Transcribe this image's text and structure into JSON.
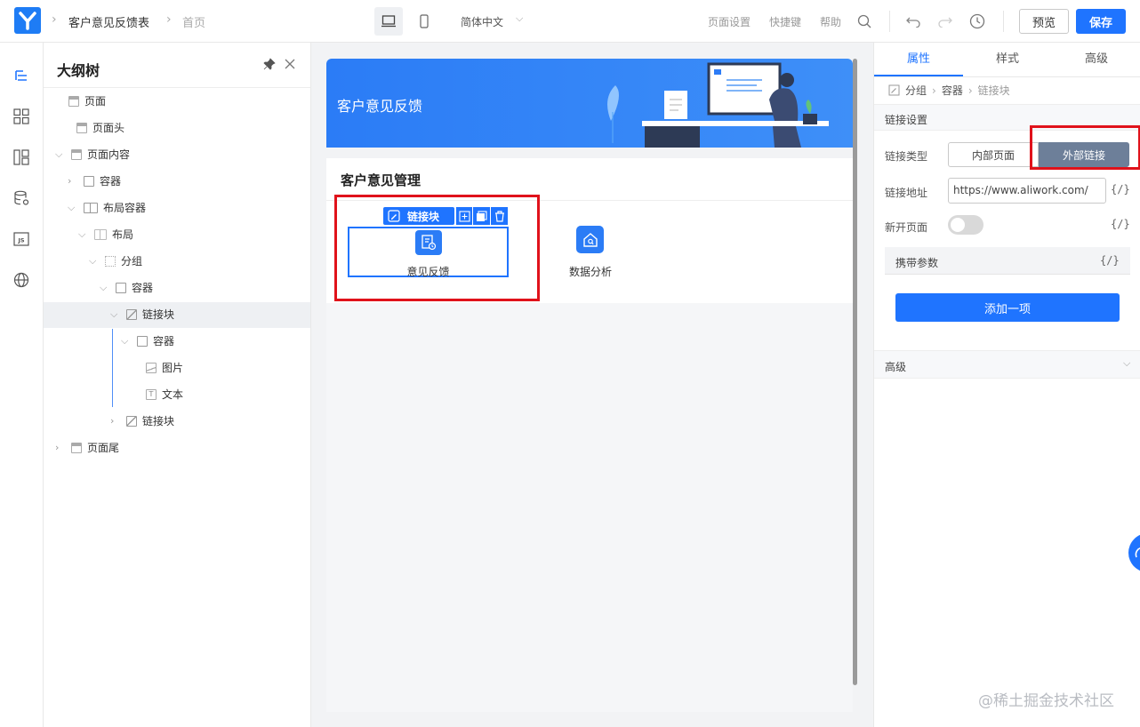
{
  "topbar": {
    "breadcrumb_form": "客户意见反馈表",
    "breadcrumb_page": "首页",
    "language": "简体中文",
    "page_settings": "页面设置",
    "shortcuts": "快捷键",
    "help": "帮助",
    "preview": "预览",
    "save": "保存",
    "accent": "#1f74ff"
  },
  "outline": {
    "title": "大纲树",
    "items": [
      {
        "label": "页面",
        "icon": "layout-icon"
      },
      {
        "label": "页面头",
        "icon": "layout-icon"
      },
      {
        "label": "页面内容",
        "icon": "layout-icon"
      },
      {
        "label": "容器",
        "icon": "container-icon"
      },
      {
        "label": "布局容器",
        "icon": "columns-icon"
      },
      {
        "label": "布局",
        "icon": "columns-icon"
      },
      {
        "label": "分组",
        "icon": "group-icon"
      },
      {
        "label": "容器",
        "icon": "container-icon"
      },
      {
        "label": "链接块",
        "icon": "link-block-icon"
      },
      {
        "label": "容器",
        "icon": "container-icon"
      },
      {
        "label": "图片",
        "icon": "image-icon"
      },
      {
        "label": "文本",
        "icon": "text-icon"
      },
      {
        "label": "链接块",
        "icon": "link-block-icon"
      },
      {
        "label": "页面尾",
        "icon": "layout-icon"
      }
    ]
  },
  "canvas": {
    "banner_title": "客户意见反馈",
    "section_title": "客户意见管理",
    "toolbar_label": "链接块",
    "links": [
      {
        "label": "意见反馈",
        "icon": "feedback-form-icon"
      },
      {
        "label": "数据分析",
        "icon": "home-search-icon"
      }
    ],
    "watermark": "@稀土掘金技术社区"
  },
  "panel": {
    "tabs": [
      "属性",
      "样式",
      "高级"
    ],
    "breadcrumb": [
      "分组",
      "容器",
      "链接块"
    ],
    "section": "链接设置",
    "link_type_label": "链接类型",
    "link_type_options": [
      "内部页面",
      "外部链接"
    ],
    "link_type_selected": "外部链接",
    "link_addr_label": "链接地址",
    "link_addr_value": "https://www.aliwork.com/",
    "new_page_label": "新开页面",
    "new_page_on": false,
    "params_label": "携带参数",
    "var_symbol": "{/}",
    "add_item": "添加一项",
    "advanced": "高级"
  }
}
